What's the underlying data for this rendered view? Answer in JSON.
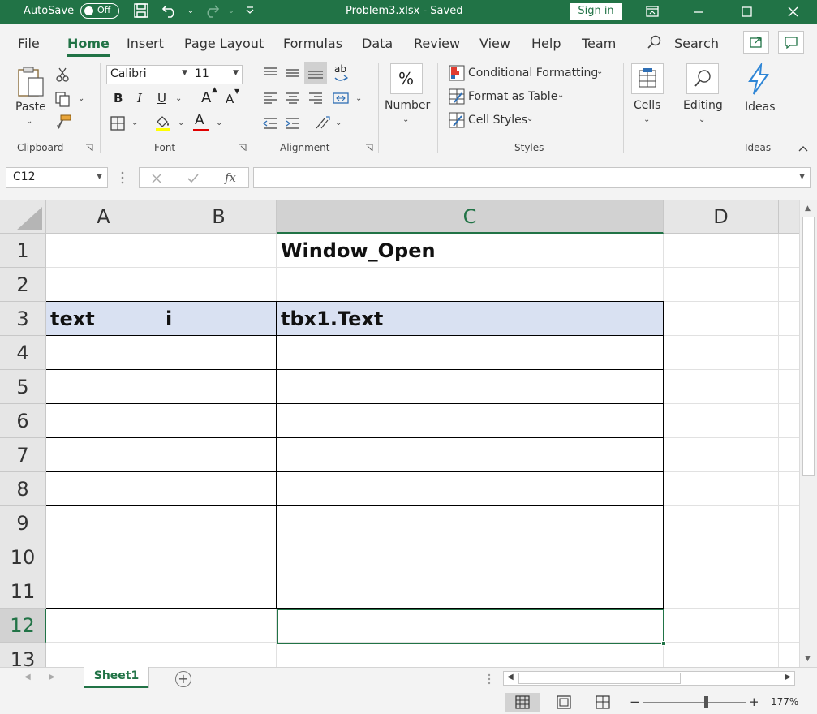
{
  "titlebar": {
    "autosave_label": "AutoSave",
    "autosave_state": "Off",
    "file_title": "Problem3.xlsx  -  Saved",
    "signin_label": "Sign in"
  },
  "tabs": [
    "File",
    "Home",
    "Insert",
    "Page Layout",
    "Formulas",
    "Data",
    "Review",
    "View",
    "Help",
    "Team"
  ],
  "active_tab": "Home",
  "search_label": "Search",
  "ribbon": {
    "paste_label": "Paste",
    "font_name": "Calibri",
    "font_size": "11",
    "number_label": "Number",
    "number_symbol": "%",
    "styles": {
      "conditional_formatting": "Conditional Formatting",
      "format_as_table": "Format as Table",
      "cell_styles": "Cell Styles"
    },
    "cells_label": "Cells",
    "editing_label": "Editing",
    "ideas_label": "Ideas",
    "groups": {
      "clipboard": "Clipboard",
      "font": "Font",
      "alignment": "Alignment",
      "styles": "Styles",
      "ideas": "Ideas"
    },
    "bold": "B",
    "italic": "I",
    "underline": "U",
    "font_color_letter": "A",
    "grow_font": "A",
    "shrink_font": "A",
    "wrap_text_glyph": "ab",
    "accent_color": "#217346",
    "font_color_bar": "#e00000",
    "ideas_color": "#2f86d6"
  },
  "formula_bar": {
    "name_box": "C12",
    "fx_label": "fx",
    "formula": ""
  },
  "grid": {
    "columns": [
      "A",
      "B",
      "C",
      "D"
    ],
    "selected_column": "C",
    "rows": [
      "1",
      "2",
      "3",
      "4",
      "5",
      "6",
      "7",
      "8",
      "9",
      "10",
      "11",
      "12",
      "13"
    ],
    "selected_row": "12",
    "cells": {
      "C1": "Window_Open",
      "A3": "text",
      "B3": "i",
      "C3": "tbx1.Text"
    },
    "header_fill": "#d9e1f2"
  },
  "sheets": {
    "tabs": [
      "Sheet1"
    ],
    "active": "Sheet1",
    "add_label": "+"
  },
  "status": {
    "zoom_minus": "−",
    "zoom_plus": "+",
    "zoom_level": "177%",
    "zoom_fraction": 0.59
  }
}
